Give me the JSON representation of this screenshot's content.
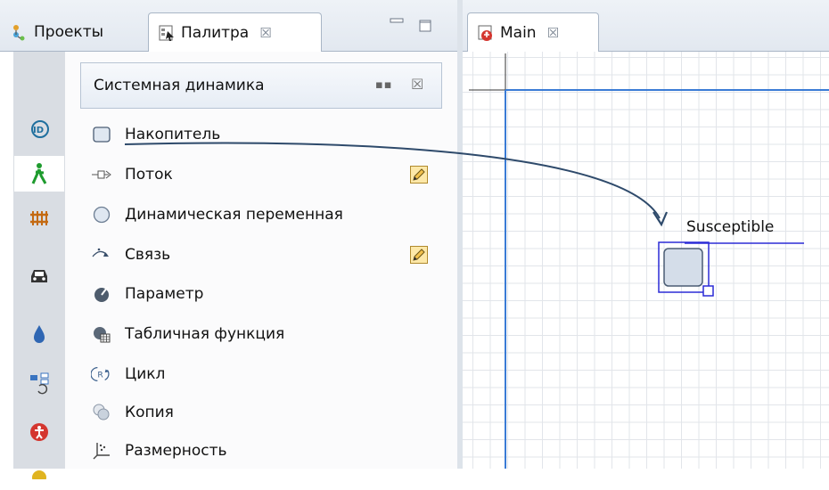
{
  "left_tabs": {
    "projects_label": "Проекты",
    "palette_label": "Палитра",
    "close_glyph": "☒"
  },
  "palette": {
    "section_title": "Системная динамика",
    "items": [
      {
        "label": "Накопитель",
        "icon": "stock-icon"
      },
      {
        "label": "Поток",
        "icon": "flow-icon",
        "editable": true
      },
      {
        "label": "Динамическая переменная",
        "icon": "dynamic-variable-icon"
      },
      {
        "label": "Связь",
        "icon": "link-icon",
        "editable": true
      },
      {
        "label": "Параметр",
        "icon": "parameter-icon"
      },
      {
        "label": "Табличная функция",
        "icon": "table-function-icon"
      },
      {
        "label": "Цикл",
        "icon": "loop-icon"
      },
      {
        "label": "Копия",
        "icon": "copy-icon"
      },
      {
        "label": "Размерность",
        "icon": "dimension-icon"
      }
    ]
  },
  "sidebar_icons": [
    "system-dynamics-icon",
    "pedestrian-icon",
    "rail-icon",
    "road-traffic-icon",
    "fluid-icon",
    "process-modeling-icon",
    "agent-icon"
  ],
  "editor": {
    "tab_label": "Main",
    "close_glyph": "☒",
    "element_label": "Susceptible"
  },
  "colors": {
    "selection": "#2b2bd6",
    "arrow": "#2e4a6b",
    "axis": "#3a7bd5"
  }
}
